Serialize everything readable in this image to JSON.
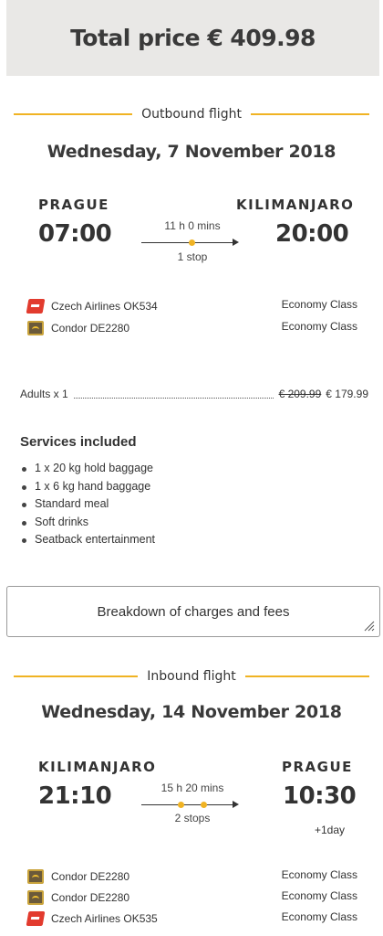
{
  "total": {
    "label": "Total price € 409.98"
  },
  "outbound": {
    "heading": "Outbound flight",
    "date": "Wednesday, 7 November 2018",
    "from_city": "PRAGUE",
    "to_city": "KILIMANJARO",
    "depart_time": "07:00",
    "arrive_time": "20:00",
    "duration": "11 h 0 mins",
    "stops": "1 stop",
    "carriers": [
      {
        "name": "Czech Airlines OK534",
        "cabin": "Economy Class",
        "logo": "czech-airlines-logo"
      },
      {
        "name": "Condor DE2280",
        "cabin": "Economy Class",
        "logo": "condor-logo"
      }
    ]
  },
  "pricing": {
    "passengers": "Adults x 1",
    "old_price": "€ 209.99",
    "new_price": "€ 179.99"
  },
  "services": {
    "title": "Services included",
    "items": [
      "1 x 20 kg hold baggage",
      "1 x 6 kg hand baggage",
      "Standard meal",
      "Soft drinks",
      "Seatback entertainment"
    ]
  },
  "breakdown": {
    "label": "Breakdown of charges and fees"
  },
  "inbound": {
    "heading": "Inbound flight",
    "date": "Wednesday, 14 November 2018",
    "from_city": "KILIMANJARO",
    "to_city": "PRAGUE",
    "depart_time": "21:10",
    "arrive_time": "10:30",
    "next_day": "+1day",
    "duration": "15 h 20 mins",
    "stops": "2 stops",
    "carriers": [
      {
        "name": "Condor DE2280",
        "cabin": "Economy Class",
        "logo": "condor-logo"
      },
      {
        "name": "Condor DE2280",
        "cabin": "Economy Class",
        "logo": "condor-logo"
      },
      {
        "name": "Czech Airlines OK535",
        "cabin": "Economy Class",
        "logo": "czech-airlines-logo"
      }
    ]
  },
  "colors": {
    "accent": "#f0b323",
    "header_bg": "#e9e8e6"
  }
}
